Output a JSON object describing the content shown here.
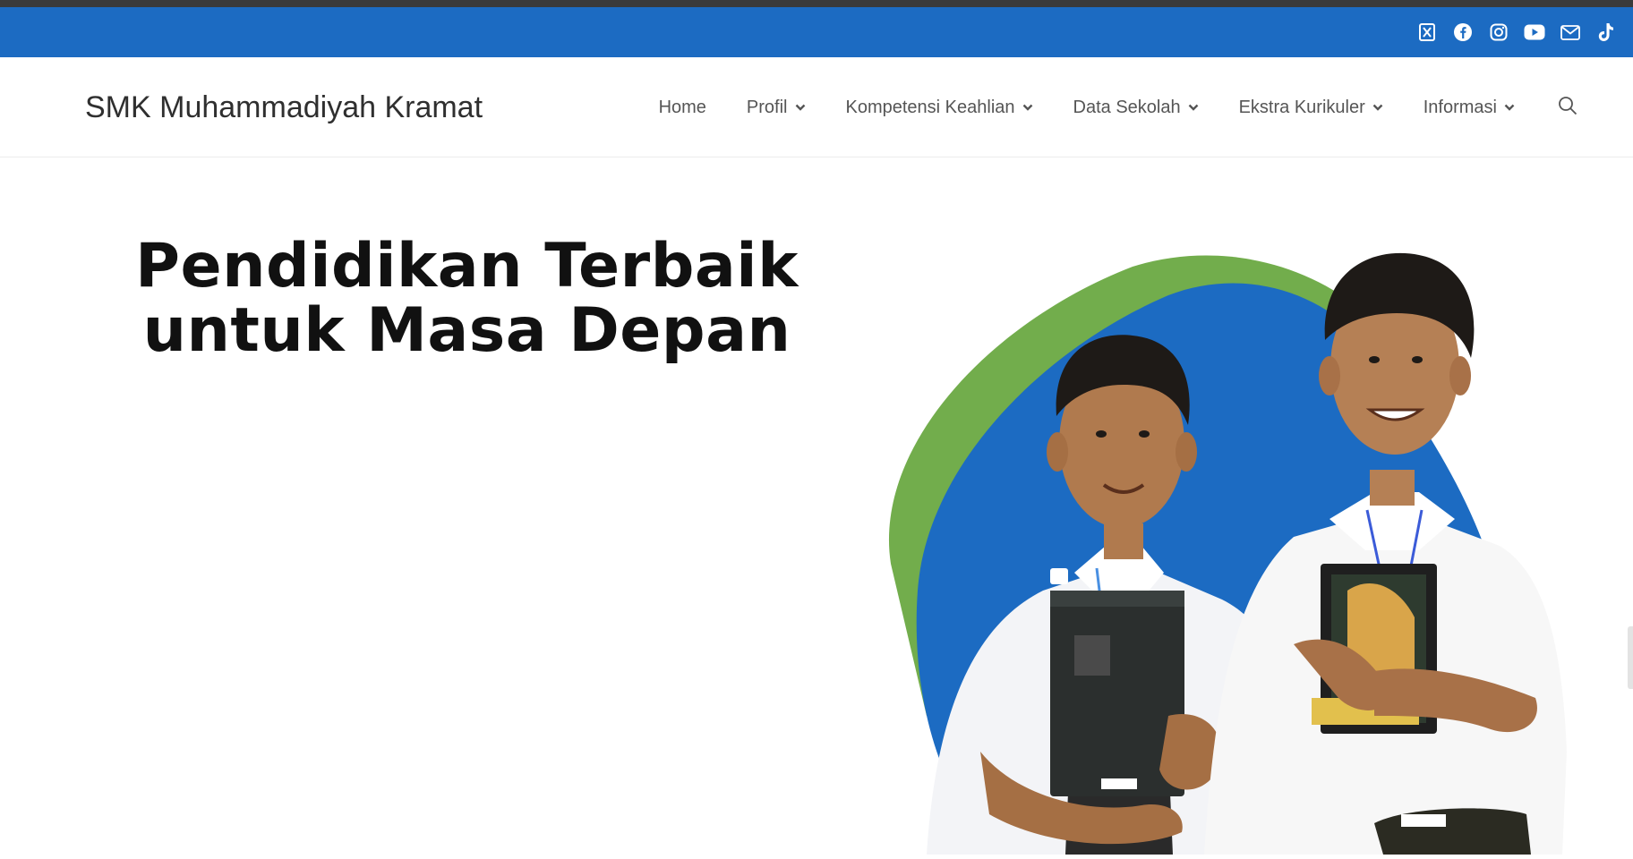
{
  "topbar": {
    "background_color": "#1c6bc2",
    "social_icons": [
      {
        "name": "x-twitter-icon"
      },
      {
        "name": "facebook-icon"
      },
      {
        "name": "instagram-icon"
      },
      {
        "name": "youtube-icon"
      },
      {
        "name": "email-icon"
      },
      {
        "name": "tiktok-icon"
      }
    ]
  },
  "header": {
    "site_title": "SMK Muhammadiyah Kramat",
    "nav": {
      "home": "Home",
      "profil": "Profil",
      "kompetensi": "Kompetensi Keahlian",
      "data_sekolah": "Data Sekolah",
      "ekstra": "Ekstra Kurikuler",
      "informasi": "Informasi"
    },
    "search_icon": "search-icon"
  },
  "hero": {
    "title_line1": "Pendidikan Terbaik",
    "title_line2": "untuk Masa Depan",
    "blob_green": "#72ad4c",
    "blob_blue": "#1c6bc2"
  }
}
